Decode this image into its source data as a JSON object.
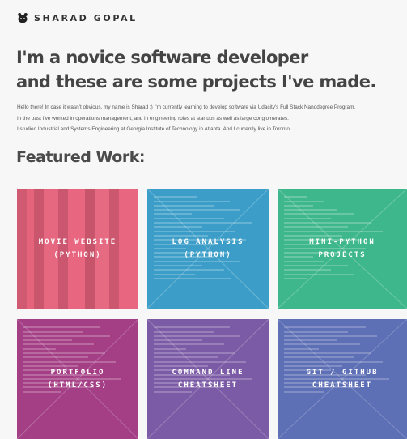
{
  "header": {
    "logo_icon": "bear-silhouette-icon",
    "brand": "SHARAD GOPAL"
  },
  "hero": {
    "line1": "I'm a novice software developer",
    "line2": "and these are some projects I've made."
  },
  "intro": {
    "p1": "Hello there! In case it wasn't obvious, my name is Sharad :) I'm currently learning to develop software via Udacity's Full Stack Nanodegree Program.",
    "p2": "In the past I've worked in operations management, and in engineering roles at startups as well as large conglomerates.",
    "p3": "I studied Industrial and Systems Engineering at Georgia Institute of Technology in Atlanta. And I currently live in Toronto."
  },
  "featured": {
    "title": "Featured Work:",
    "cards": [
      {
        "line1": "MOVIE WEBSITE",
        "line2": "(PYTHON)",
        "color": "#e8677f"
      },
      {
        "line1": "LOG ANALYSIS",
        "line2": "(PYTHON)",
        "color": "#3c9ec8"
      },
      {
        "line1": "MINI-PYTHON",
        "line2": "PROJECTS",
        "color": "#3fb78d"
      },
      {
        "line1": "PORTFOLIO",
        "line2": "(HTML/CSS)",
        "color": "#a43f86"
      },
      {
        "line1": "COMMAND LINE",
        "line2": "CHEATSHEET",
        "color": "#7c5ba6"
      },
      {
        "line1": "GIT / GITHUB",
        "line2": "CHEATSHEET",
        "color": "#5d6fb5"
      }
    ]
  }
}
